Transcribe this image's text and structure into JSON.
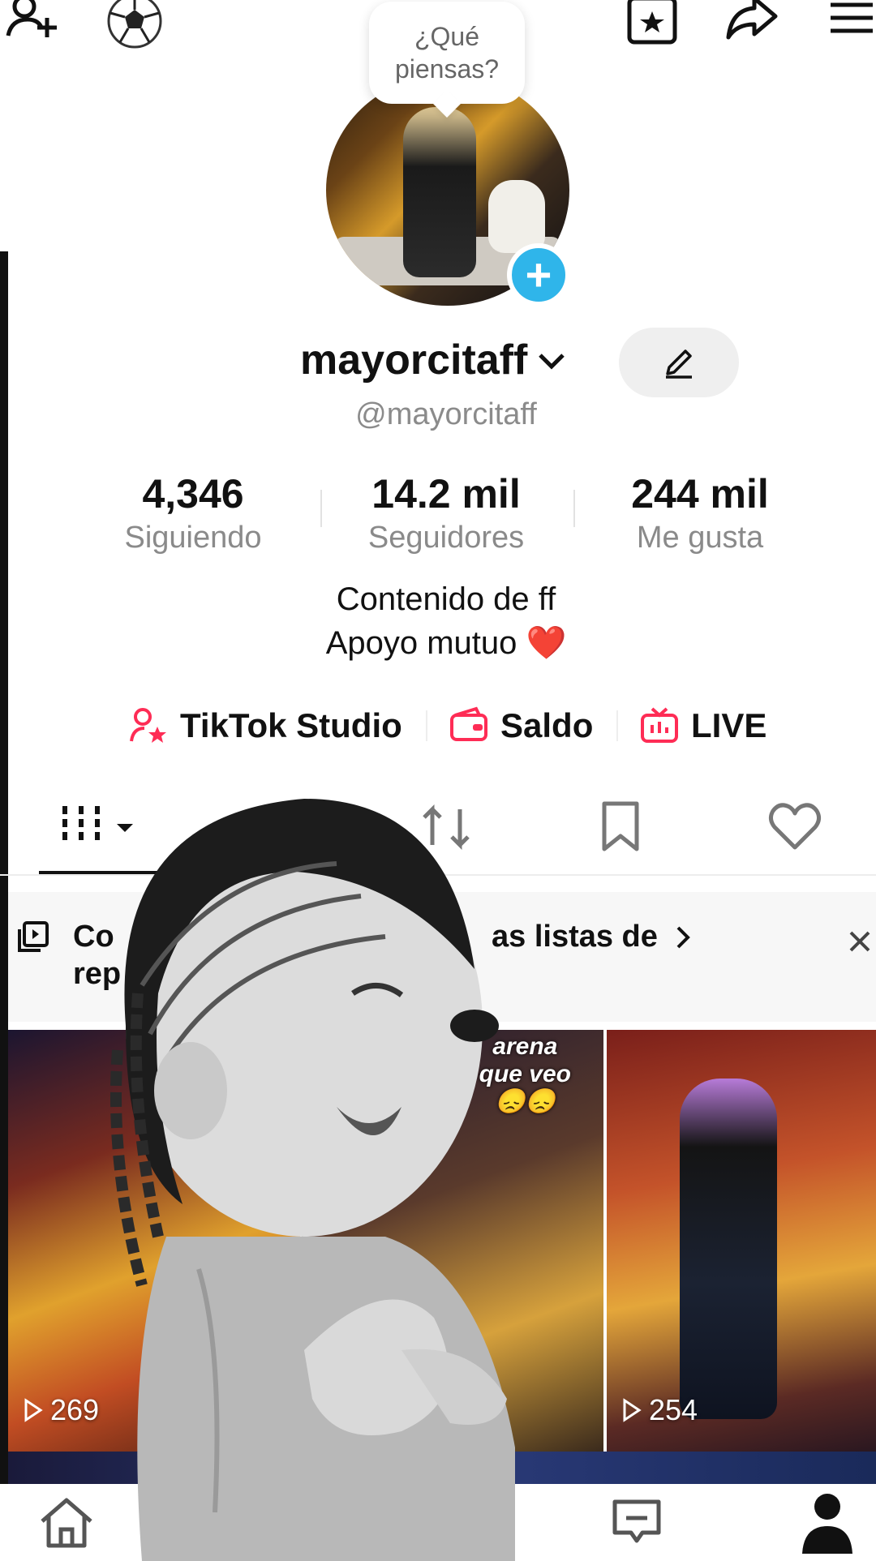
{
  "tooltip": {
    "line1": "¿Qué",
    "line2": "piensas?"
  },
  "profile": {
    "username": "mayorcitaff",
    "handle": "@mayorcitaff",
    "bio_line1": "Contenido de ff",
    "bio_line2": "Apoyo mutuo ❤️"
  },
  "stats": [
    {
      "value": "4,346",
      "label": "Siguiendo"
    },
    {
      "value": "14.2 mil",
      "label": "Seguidores"
    },
    {
      "value": "244 mil",
      "label": "Me gusta"
    }
  ],
  "quick_links": [
    {
      "label": "TikTok Studio",
      "icon": "person-star-icon"
    },
    {
      "label": "Saldo",
      "icon": "wallet-icon"
    },
    {
      "label": "LIVE",
      "icon": "tv-icon"
    }
  ],
  "banner": {
    "line1_start": "Co",
    "line1_end": "as listas de",
    "line2_start": "rep"
  },
  "videos": [
    {
      "views": "269"
    },
    {
      "views": "254"
    }
  ],
  "video_overlay_text": {
    "line1": "arena",
    "line2": "que veo",
    "emoji": "😞😞"
  },
  "colors": {
    "accent_pink": "#fe2c55",
    "badge_blue": "#2fb5ea"
  }
}
